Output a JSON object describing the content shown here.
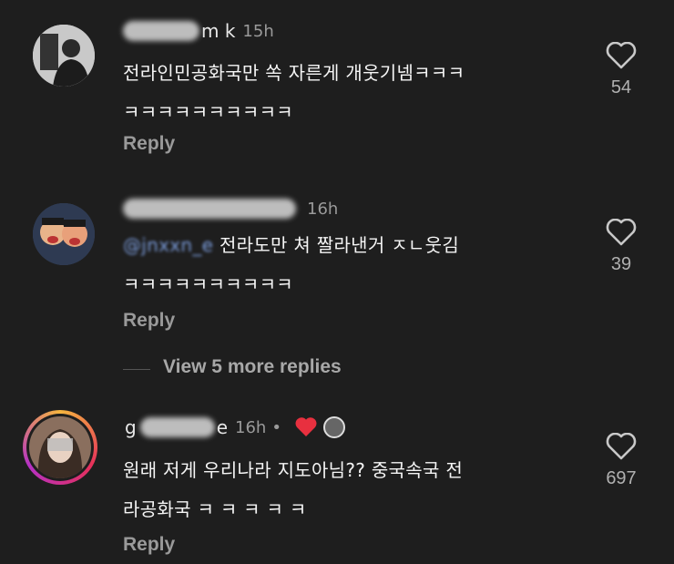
{
  "comments": [
    {
      "name_tail": "m k",
      "time": "15h",
      "text_line1": "전라인민공화국만 쏙 자른게 개웃기넴ㅋㅋㅋ",
      "text_line2": "ㅋㅋㅋㅋㅋㅋㅋㅋㅋㅋ",
      "reply": "Reply",
      "likes": "54"
    },
    {
      "time": "16h",
      "mention": "@jnxxn_e",
      "text_line1": " 전라도만 쳐 짤라낸거 ㅈㄴ웃김",
      "text_line2": "ㅋㅋㅋㅋㅋㅋㅋㅋㅋㅋ",
      "reply": "Reply",
      "likes": "39"
    },
    {
      "name_head": "g",
      "name_tail": "e",
      "time": "16h",
      "dot": "•",
      "text_line1": "원래 저게 우리나라 지도아님?? 중국속국 전",
      "text_line2": "라공화국 ㅋ ㅋ ㅋ ㅋ ㅋ",
      "reply": "Reply",
      "likes": "697"
    }
  ],
  "view_more": "View 5 more replies",
  "icons": {
    "like": "heart-outline-icon",
    "creator_like": "heart-filled-icon"
  },
  "colors": {
    "background": "#1e1e1e",
    "heart_red": "#e8303f",
    "mention": "#7d9fe0"
  }
}
